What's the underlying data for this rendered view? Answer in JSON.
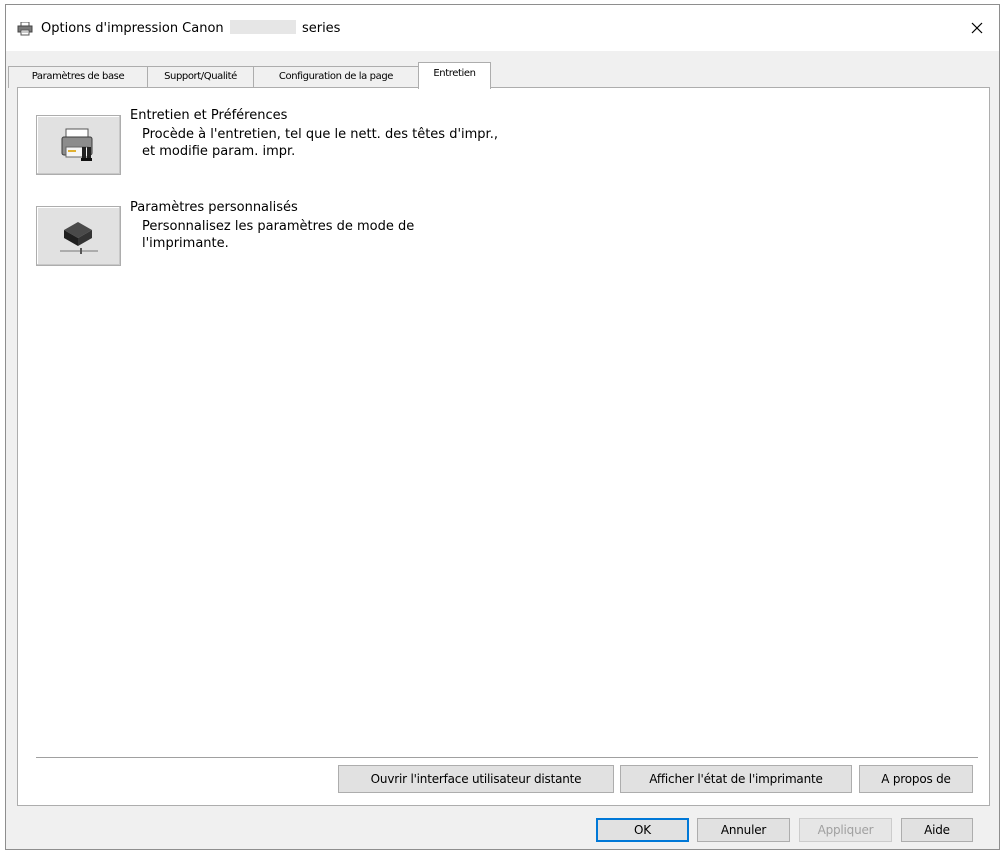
{
  "window": {
    "title_prefix": "Options d'impression Canon",
    "title_suffix": "series",
    "close_glyph": "✕"
  },
  "tabs": [
    {
      "label": "Paramètres de base",
      "active": false
    },
    {
      "label": "Support/Qualité",
      "active": false
    },
    {
      "label": "Configuration de la page",
      "active": false
    },
    {
      "label": "Entretien",
      "active": true
    }
  ],
  "maintenance": {
    "title": "Entretien et Préférences",
    "description": "Procède à l'entretien, tel que le nett. des têtes d'impr., et modifie param. impr.",
    "icon": "printer-maintenance-icon"
  },
  "custom_settings": {
    "title": "Paramètres personnalisés",
    "description": "Personnalisez les paramètres de mode de l'imprimante.",
    "icon": "printer-settings-icon"
  },
  "utility_buttons": {
    "remote_ui": "Ouvrir l'interface utilisateur distante",
    "printer_status": "Afficher l'état de l'imprimante",
    "about": "A propos de"
  },
  "dialog_buttons": {
    "ok": "OK",
    "cancel": "Annuler",
    "apply": "Appliquer",
    "help": "Aide"
  },
  "colors": {
    "focus_border": "#0078d7",
    "button_face": "#e1e1e1"
  }
}
